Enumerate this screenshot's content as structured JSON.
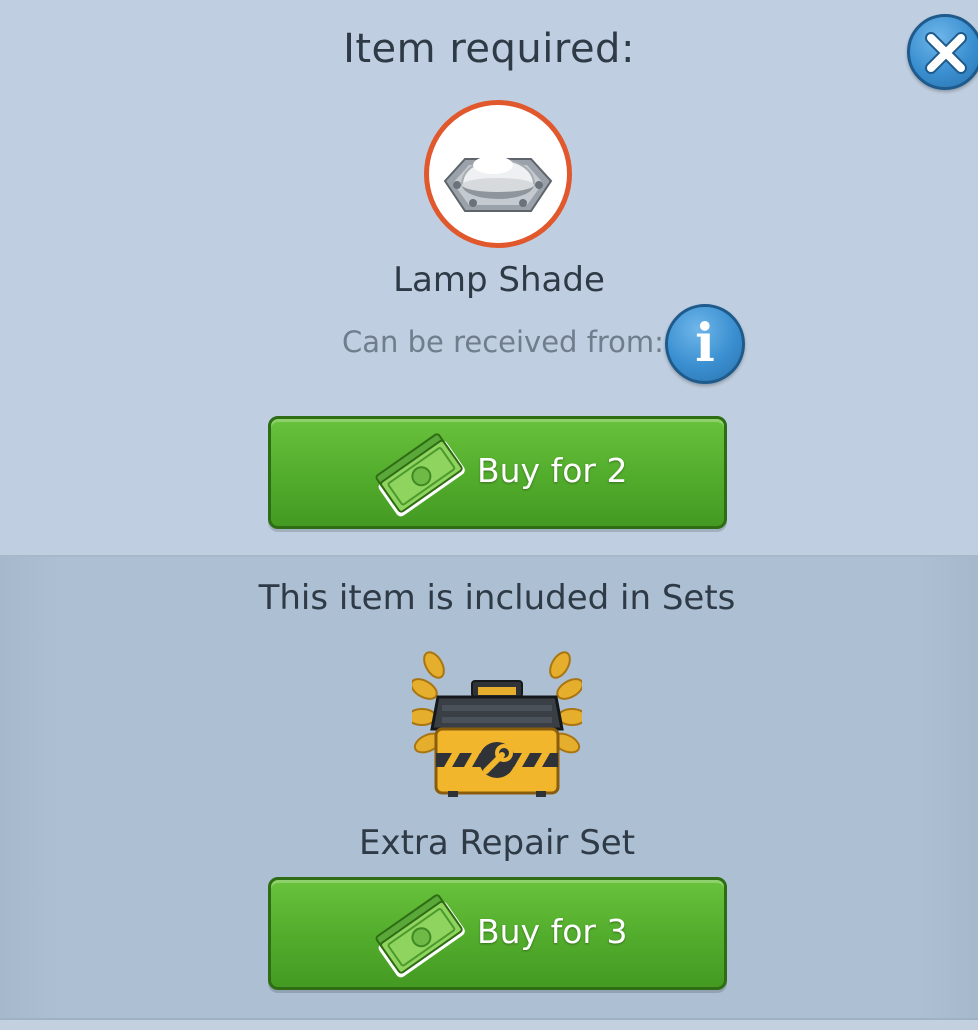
{
  "dialog": {
    "title": "Item required:",
    "close_icon": "close-x-icon",
    "colors": {
      "panel_top": "#bfcee0",
      "panel_bottom": "#adbfd2",
      "button_green": "#52ac2c",
      "item_ring": "#e0582c",
      "info_blue": "#3a8fd0"
    }
  },
  "item": {
    "icon": "lamp-shade-icon",
    "name": "Lamp Shade",
    "source_label": "Can be received from:",
    "info_icon": "info-icon",
    "buy_label": "Buy for 2",
    "currency_icon": "cash-icon"
  },
  "sets": {
    "heading": "This item is included in Sets",
    "set_icon": "repair-toolbox-icon",
    "set_name": "Extra Repair Set",
    "buy_label": "Buy for 3",
    "currency_icon": "cash-icon"
  }
}
